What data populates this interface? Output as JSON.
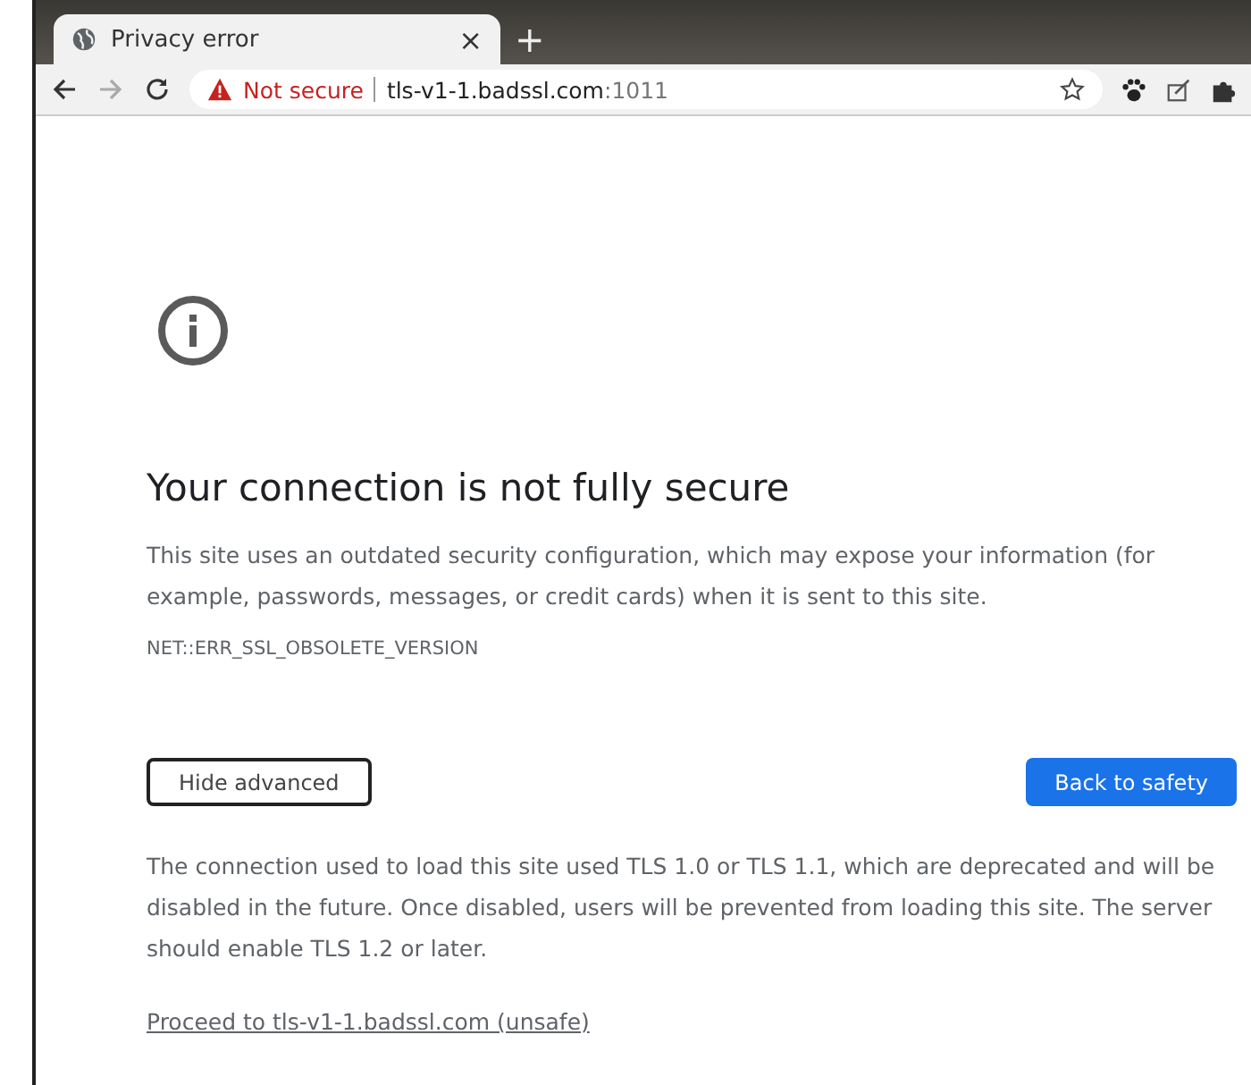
{
  "tab": {
    "title": "Privacy error",
    "close": "×",
    "new_tab": "+"
  },
  "toolbar": {
    "security_label": "Not secure",
    "url_host": "tls-v1-1.badssl.com",
    "url_port": ":1011"
  },
  "page": {
    "heading": "Your connection is not fully secure",
    "body": "This site uses an outdated security configuration, which may expose your information (for example, passwords, messages, or credit cards) when it is sent to this site.",
    "error_code": "NET::ERR_SSL_OBSOLETE_VERSION",
    "buttons": [
      {
        "label": "Hide advanced",
        "kind": "secondary"
      },
      {
        "label": "Back to safety",
        "kind": "primary"
      }
    ],
    "details": "The connection used to load this site used TLS 1.0 or TLS 1.1, which are deprecated and will be disabled in the future. Once disabled, users will be prevented from loading this site. The server should enable TLS 1.2 or later.",
    "proceed_link": "Proceed to tls-v1-1.badssl.com (unsafe)"
  }
}
